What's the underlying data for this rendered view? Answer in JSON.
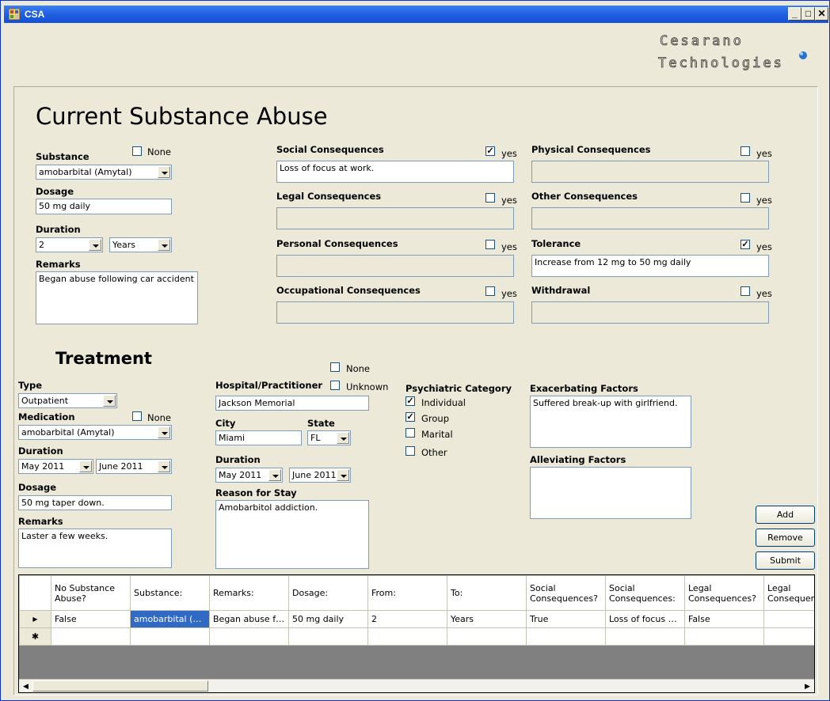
{
  "window": {
    "title": "CSA",
    "min": "_",
    "max": "□",
    "close": "✕"
  },
  "logo": {
    "line1": "Cesarano",
    "line2": "Technologies"
  },
  "csa": {
    "heading": "Current Substance Abuse",
    "substance_label": "Substance",
    "none_label": "None",
    "substance_value": "amobarbital (Amytal)",
    "dosage_label": "Dosage",
    "dosage_value": "50 mg daily",
    "duration_label": "Duration",
    "duration_num": "2",
    "duration_unit": "Years",
    "remarks_label": "Remarks",
    "remarks_value": "Began abuse following car accident"
  },
  "consequences": {
    "yes_label": "yes",
    "social": {
      "label": "Social Consequences",
      "checked": true,
      "value": "Loss of focus at work."
    },
    "legal": {
      "label": "Legal Consequences",
      "checked": false,
      "value": ""
    },
    "personal": {
      "label": "Personal Consequences",
      "checked": false,
      "value": ""
    },
    "occupational": {
      "label": "Occupational Consequences",
      "checked": false,
      "value": ""
    },
    "physical": {
      "label": "Physical Consequences",
      "checked": false,
      "value": ""
    },
    "other": {
      "label": "Other Consequences",
      "checked": false,
      "value": ""
    },
    "tolerance": {
      "label": "Tolerance",
      "checked": true,
      "value": "Increase from 12 mg to 50 mg daily"
    },
    "withdrawal": {
      "label": "Withdrawal",
      "checked": false,
      "value": ""
    }
  },
  "treatment": {
    "heading": "Treatment",
    "type_label": "Type",
    "type_value": "Outpatient",
    "medication_label": "Medication",
    "none_label": "None",
    "medication_value": "amobarbital (Amytal)",
    "duration_label": "Duration",
    "dur_from": "May 2011",
    "dur_to": "June 2011",
    "dosage_label": "Dosage",
    "dosage_value": "50 mg taper down.",
    "remarks_label": "Remarks",
    "remarks_value": "Laster a few weeks.",
    "hospital_label": "Hospital/Practitioner",
    "hospital_none": "None",
    "hospital_unknown": "Unknown",
    "hospital_value": "Jackson Memorial",
    "city_label": "City",
    "city_value": "Miami",
    "state_label": "State",
    "state_value": "FL",
    "hosp_duration_label": "Duration",
    "hosp_from": "May 2011",
    "hosp_to": "June 2011",
    "reason_label": "Reason for Stay",
    "reason_value": "Amobarbitol addiction.",
    "psych_label": "Psychiatric Category",
    "psych": [
      {
        "label": "Individual",
        "checked": true
      },
      {
        "label": "Group",
        "checked": true
      },
      {
        "label": "Marital",
        "checked": false
      },
      {
        "label": "Other",
        "checked": false
      }
    ],
    "exacerbating_label": "Exacerbating Factors",
    "exacerbating_value": "Suffered break-up with girlfriend.",
    "alleviating_label": "Alleviating Factors",
    "alleviating_value": ""
  },
  "buttons": {
    "add": "Add",
    "remove": "Remove",
    "submit": "Submit"
  },
  "grid": {
    "headers": [
      "No Substance Abuse?",
      "Substance:",
      "Remarks:",
      "Dosage:",
      "From:",
      "To:",
      "Social Consequences?",
      "Social Consequences:",
      "Legal Consequences?",
      "Legal Consequences:"
    ],
    "rows": [
      [
        "False",
        "amobarbital (Amytal)",
        "Began abuse following car accident",
        "50 mg daily",
        "2",
        "Years",
        "True",
        "Loss of focus at work.",
        "False",
        ""
      ]
    ],
    "current_row_marker": "▶",
    "new_row_marker": "✱"
  }
}
